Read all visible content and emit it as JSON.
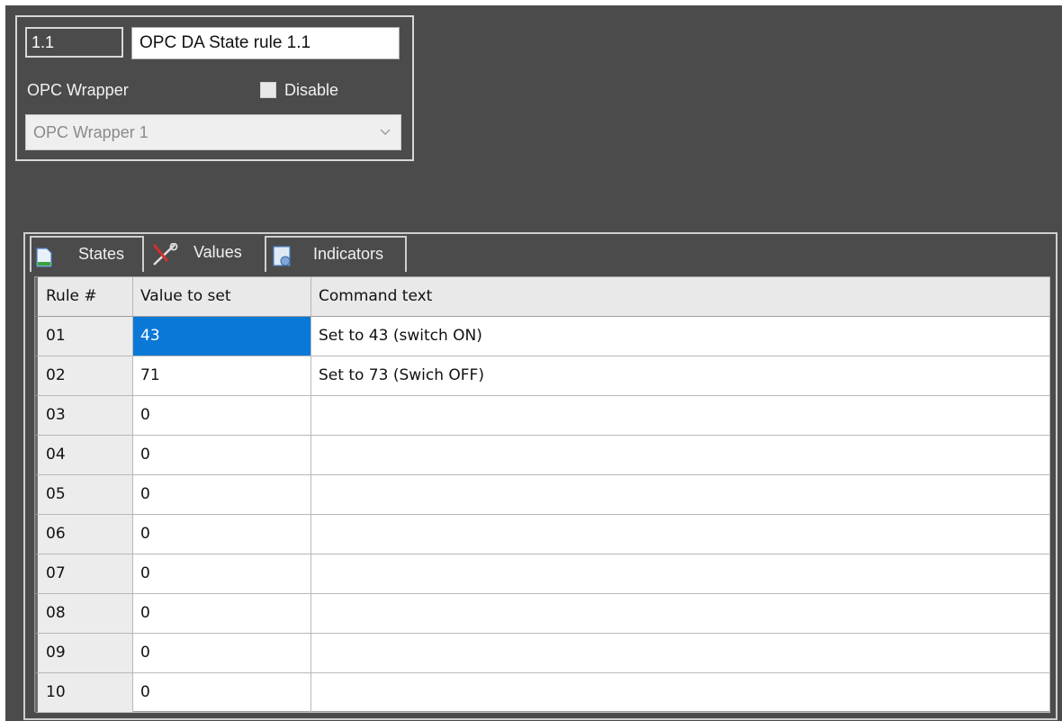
{
  "rule_id": "1.1",
  "rule_name": "OPC DA State rule 1.1",
  "wrapper_label": "OPC Wrapper",
  "disable_label": "Disable",
  "disable_checked": false,
  "wrapper_select": {
    "value": "OPC Wrapper 1",
    "chevron_icon": "chevron-down-icon"
  },
  "tabs": [
    {
      "label": "States",
      "icon": "document-icon",
      "active": false
    },
    {
      "label": "Values",
      "icon": "tools-icon",
      "active": true
    },
    {
      "label": "Indicators",
      "icon": "indicators-icon",
      "active": false
    }
  ],
  "table": {
    "headers": [
      "Rule #",
      "Value to set",
      "Command text"
    ],
    "rows": [
      {
        "rule": "01",
        "value": "43",
        "command": "Set to 43 (switch ON)",
        "selected": true
      },
      {
        "rule": "02",
        "value": "71",
        "command": "Set to 73 (Swich OFF)"
      },
      {
        "rule": "03",
        "value": "0",
        "command": ""
      },
      {
        "rule": "04",
        "value": "0",
        "command": ""
      },
      {
        "rule": "05",
        "value": "0",
        "command": ""
      },
      {
        "rule": "06",
        "value": "0",
        "command": ""
      },
      {
        "rule": "07",
        "value": "0",
        "command": ""
      },
      {
        "rule": "08",
        "value": "0",
        "command": ""
      },
      {
        "rule": "09",
        "value": "0",
        "command": ""
      },
      {
        "rule": "10",
        "value": "0",
        "command": ""
      }
    ]
  },
  "colors": {
    "background": "#4b4b4b",
    "selection": "#0a78d7"
  }
}
